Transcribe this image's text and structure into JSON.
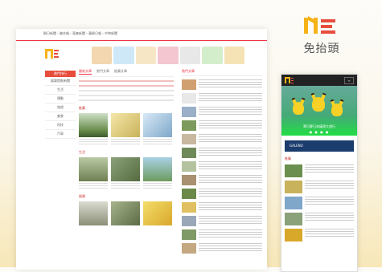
{
  "brand": {
    "title": "免抬頭",
    "colors": {
      "yellow": "#f5b318",
      "red": "#e84d3c"
    }
  },
  "desktop": {
    "topbar_text": "朝日新聞・聯合報・東森新聞・蘋果日報・中時新聞",
    "sidebar": {
      "head": "熱門排行",
      "items": [
        "娛樂焦點新聞",
        "生活",
        "運動",
        "旅遊",
        "美食",
        "科技",
        "汽車"
      ]
    },
    "tabs": [
      "最新文章",
      "熱門文章",
      "推薦文章"
    ],
    "sections": [
      "推薦",
      "生活",
      "娛樂"
    ],
    "right_title": "熱門文章"
  },
  "phone": {
    "menu_label": "≡",
    "hero_caption": "寶可夢日本橫濱大遊行",
    "ad_text": "GALENO",
    "section_title": "推薦"
  }
}
